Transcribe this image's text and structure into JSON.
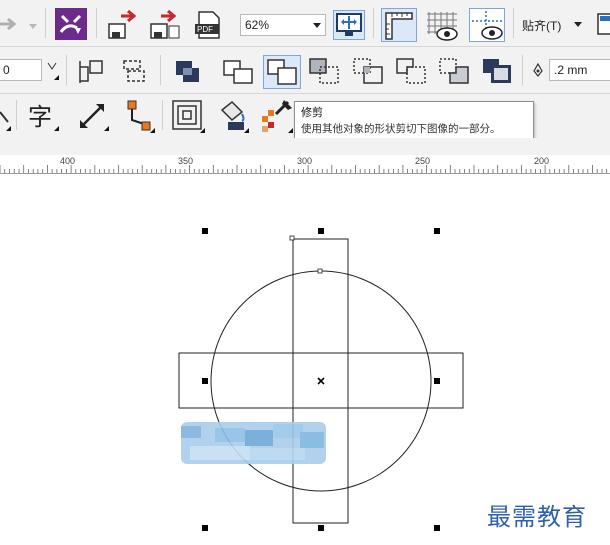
{
  "toolbar": {
    "zoom_value": "62%",
    "snap_label": "贴齐(T)"
  },
  "property_bar": {
    "left_field_value": "0",
    "outline_width_value": ".2 mm"
  },
  "tooltip": {
    "title": "修剪",
    "description": "使用其他对象的形状剪切下图像的一部分。"
  },
  "ruler": {
    "labels": [
      "400",
      "350",
      "300",
      "250",
      "200"
    ]
  },
  "watermark": "最需教育",
  "colors": {
    "toolbar_bg": "#f2f2f2",
    "icon_dark": "#2b3a5c",
    "icon_red": "#c8262a",
    "icon_purple": "#6c2a8a",
    "watermark_blue": "#2f5fb3",
    "blur_blue": "#8fbde3"
  },
  "icons": [
    "forward-arrow-icon",
    "app-launcher-icon",
    "import-icon",
    "export-icon",
    "pdf-icon",
    "full-screen-preview-icon",
    "rulers-icon",
    "grid-icon",
    "guidelines-icon",
    "settings-icon",
    "weld-icon",
    "trim-icon",
    "intersect-icon",
    "simplify-icon",
    "front-minus-back-icon",
    "back-minus-front-icon",
    "boundary-icon",
    "text-tool-icon",
    "dimension-tool-icon",
    "connector-tool-icon",
    "contour-tool-icon",
    "fill-tool-icon",
    "eyedropper-icon",
    "pen-nib-icon"
  ]
}
